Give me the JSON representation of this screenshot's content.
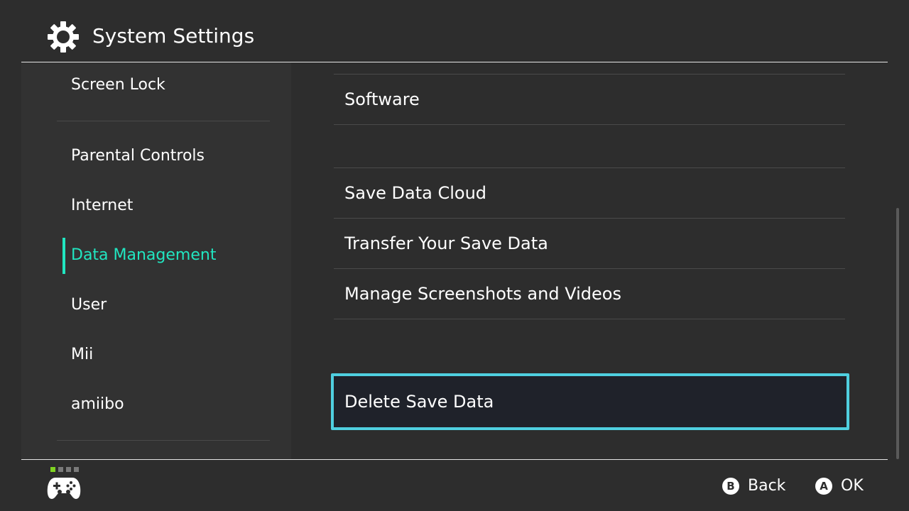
{
  "header": {
    "title": "System Settings",
    "icon": "gear-icon"
  },
  "sidebar": {
    "items": [
      {
        "label": "Screen Lock"
      },
      {
        "label": "Parental Controls"
      },
      {
        "label": "Internet"
      },
      {
        "label": "Data Management",
        "selected": true
      },
      {
        "label": "User"
      },
      {
        "label": "Mii"
      },
      {
        "label": "amiibo"
      }
    ]
  },
  "main": {
    "rows": [
      {
        "label": "Software"
      },
      {
        "label": "Save Data Cloud"
      },
      {
        "label": "Transfer Your Save Data"
      },
      {
        "label": "Manage Screenshots and Videos"
      },
      {
        "label": "Delete Save Data",
        "focused": true
      }
    ]
  },
  "footer": {
    "controller_icon": "gamepad-icon",
    "back": {
      "button": "B",
      "label": "Back"
    },
    "ok": {
      "button": "A",
      "label": "OK"
    }
  },
  "colors": {
    "background": "#2d2d2d",
    "sidebar_background": "#323232",
    "accent_selected": "#21e6c1",
    "focus_border": "#4fcfe0",
    "focus_fill": "#1f222a",
    "controller_dot_active": "#7ed321",
    "controller_dot_inactive": "#7a7a7a"
  }
}
